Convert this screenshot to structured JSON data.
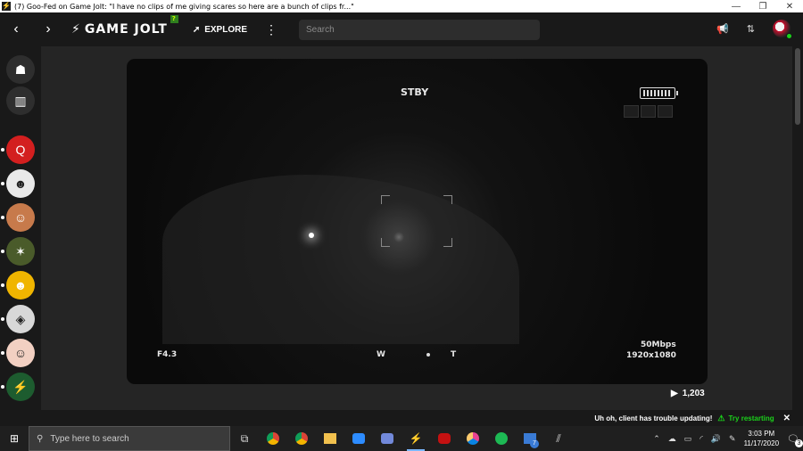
{
  "window": {
    "title": "(7) Goo-Fed on Game Jolt: \"I have no clips of me giving scares so here are a bunch of clips fr...\"",
    "minimize": "—",
    "restore": "❐",
    "close": "✕"
  },
  "topbar": {
    "back": "‹",
    "forward": "›",
    "logo_text": "GAME JOLT",
    "logo_badge": "?",
    "explore_label": "EXPLORE",
    "more": "⋮",
    "search_placeholder": "Search"
  },
  "sidebar": {
    "items": [
      {
        "name": "sidebar-item-home",
        "glyph": "☗",
        "dot": false
      },
      {
        "name": "sidebar-item-library",
        "glyph": "▥",
        "dot": false
      },
      {
        "name": "sidebar-item-community-q",
        "glyph": "Q",
        "dot": true,
        "color": "#d31f1f"
      },
      {
        "name": "sidebar-item-community-face",
        "glyph": "☻",
        "dot": true,
        "color": "#e9e9e9"
      },
      {
        "name": "sidebar-item-community-avatar1",
        "glyph": "☺",
        "dot": true,
        "color": "#c77a4b"
      },
      {
        "name": "sidebar-item-community-creature",
        "glyph": "✶",
        "dot": true,
        "color": "#4a5b2a"
      },
      {
        "name": "sidebar-item-community-bendy",
        "glyph": "☻",
        "dot": true,
        "color": "#f0b500"
      },
      {
        "name": "sidebar-item-community-roblox",
        "glyph": "◈",
        "dot": true,
        "color": "#d8d8d8"
      },
      {
        "name": "sidebar-item-community-anime",
        "glyph": "☺",
        "dot": true,
        "color": "#f2d0c2"
      },
      {
        "name": "sidebar-item-community-gamejolt",
        "glyph": "⚡",
        "dot": true,
        "color": "#1d5c2f"
      }
    ]
  },
  "video": {
    "stby": "STBY",
    "fnumber": "F4.3",
    "zoom_w": "W",
    "zoom_t": "T",
    "bitrate": "50Mbps",
    "resolution": "1920x1080"
  },
  "post": {
    "views": "1,203"
  },
  "notice": {
    "message": "Uh oh, client has trouble updating!",
    "retry_label": "Try restarting",
    "close": "✕"
  },
  "taskbar": {
    "search_placeholder": "Type here to search",
    "clock_time": "3:03 PM",
    "clock_date": "11/17/2020",
    "notification_count": "3",
    "badge_count": "7"
  },
  "colors": {
    "accent_green": "#1bd21b",
    "gamejolt_lime": "#ccff00"
  }
}
